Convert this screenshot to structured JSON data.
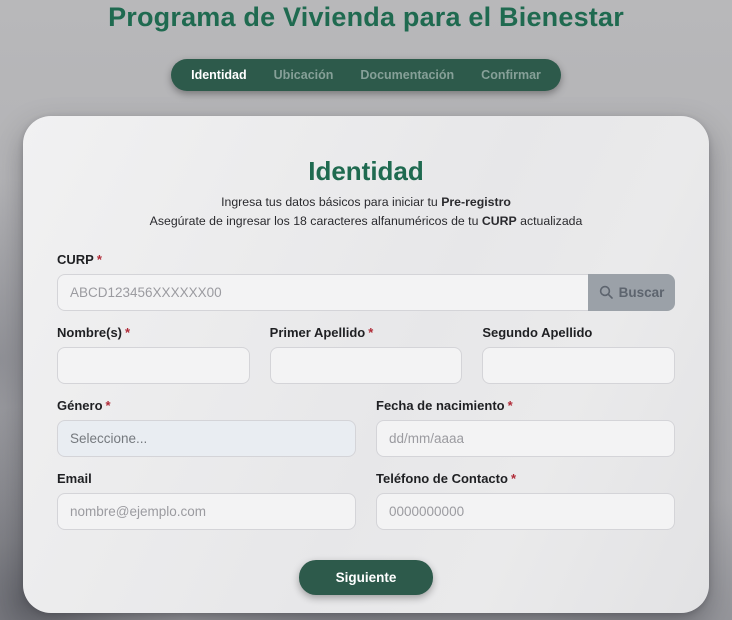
{
  "colors": {
    "brand_green": "#1f6a50",
    "pill_green": "#2d5a4b",
    "button_green": "#2d5a4b",
    "required_red": "#b02a37",
    "buscar_gray": "#9ba1a8",
    "card_bg": "#eaeaeb",
    "page_bg": "#b0b0b3"
  },
  "header": {
    "title": "Programa de Vivienda para el Bienestar"
  },
  "tabs": [
    {
      "label": "Identidad",
      "active": true
    },
    {
      "label": "Ubicación",
      "active": false
    },
    {
      "label": "Documentación",
      "active": false
    },
    {
      "label": "Confirmar",
      "active": false
    }
  ],
  "card": {
    "heading": "Identidad",
    "subtitle1": {
      "prefix": "Ingresa tus datos básicos para iniciar tu ",
      "bold": "Pre-registro"
    },
    "subtitle2": {
      "prefix": "Asegúrate de ingresar los 18 caracteres alfanuméricos de tu ",
      "bold": "CURP",
      "suffix": " actualizada"
    }
  },
  "form": {
    "curp": {
      "label": "CURP",
      "req": "*",
      "value": "",
      "placeholder": "ABCD123456XXXXXX00",
      "buscar_label": "Buscar",
      "buscar_icon": "search"
    },
    "nombres": {
      "label": "Nombre(s)",
      "req": "*",
      "value": ""
    },
    "primer_apellido": {
      "label": "Primer Apellido",
      "req": "*",
      "value": ""
    },
    "segundo_apellido": {
      "label": "Segundo Apellido",
      "value": ""
    },
    "genero": {
      "label": "Género",
      "req": "*",
      "selected": "Seleccione..."
    },
    "fecha_nacimiento": {
      "label": "Fecha de nacimiento",
      "req": "*",
      "value": "",
      "placeholder": "dd/mm/aaaa"
    },
    "email": {
      "label": "Email",
      "value": "",
      "placeholder": "nombre@ejemplo.com"
    },
    "telefono": {
      "label": "Teléfono de Contacto",
      "req": "*",
      "value": "",
      "placeholder": "0000000000"
    },
    "submit_label": "Siguiente"
  }
}
